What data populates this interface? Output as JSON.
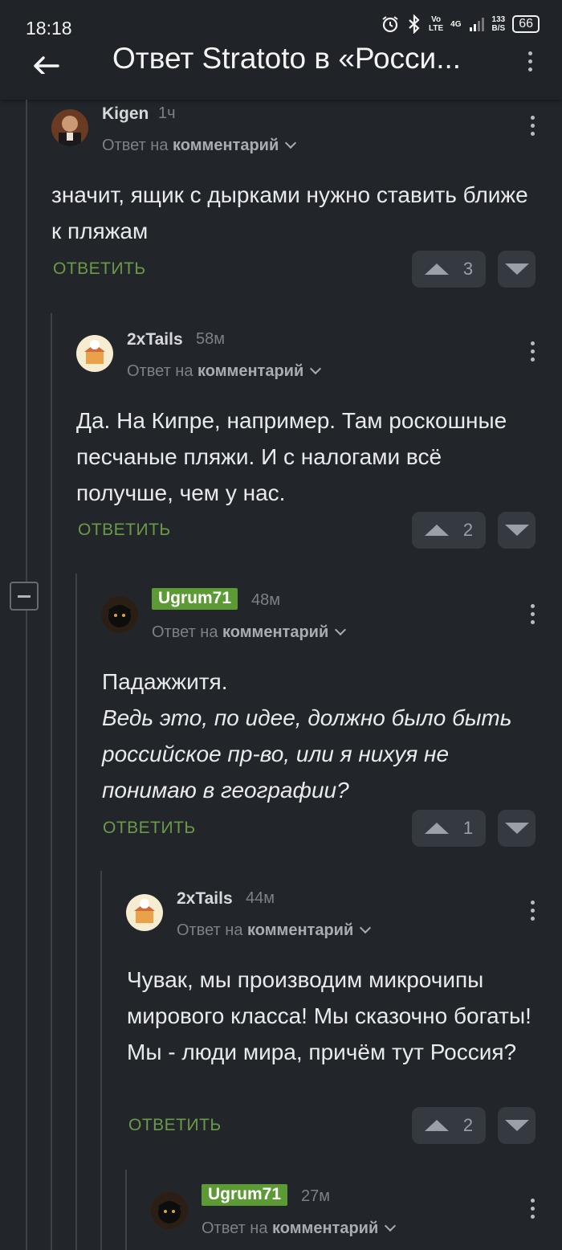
{
  "status_bar": {
    "time": "18:18",
    "network_top": "Vo",
    "network_bottom": "LTE",
    "signal_label": "4G",
    "speed_value": "133",
    "speed_unit": "B/S",
    "battery": "66"
  },
  "header": {
    "title": "Ответ Stratoto в «Росси...",
    "icons": [
      "back-arrow-icon",
      "more-vert-icon"
    ]
  },
  "comments": [
    {
      "author": "Kigen",
      "time": "1ч",
      "reply_prefix": "Ответ на",
      "reply_target": "комментарий",
      "text": "значит, ящик с дырками нужно ставить ближе к пляжам",
      "reply_label": "ОТВЕТИТЬ",
      "rating": "3"
    },
    {
      "author": "2xTails",
      "time": "58м",
      "reply_prefix": "Ответ на",
      "reply_target": "комментарий",
      "text": "Да. На Кипре, например. Там роскошные песчаные пляжи. И с налогами всё получше, чем у нас.",
      "reply_label": "ОТВЕТИТЬ",
      "rating": "2"
    },
    {
      "author": "Ugrum71",
      "time": "48м",
      "reply_prefix": "Ответ на",
      "reply_target": "комментарий",
      "text": "Падажжитя.",
      "text_italic": "Ведь это, по идее, должно было быть российское пр-во, или я нихуя не понимаю в географии?",
      "reply_label": "ОТВЕТИТЬ",
      "rating": "1"
    },
    {
      "author": "2xTails",
      "time": "44м",
      "reply_prefix": "Ответ на",
      "reply_target": "комментарий",
      "text": "Чувак, мы производим микрочипы мирового класса! Мы сказочно богаты! Мы - люди мира, причём тут Россия?",
      "reply_label": "ОТВЕТИТЬ",
      "rating": "2"
    },
    {
      "author": "Ugrum71",
      "time": "27м",
      "reply_prefix": "Ответ на",
      "reply_target": "комментарий"
    }
  ],
  "colors": {
    "background": "#22262b",
    "accent_green": "#6b9a47",
    "badge_green": "#5c9a35"
  }
}
